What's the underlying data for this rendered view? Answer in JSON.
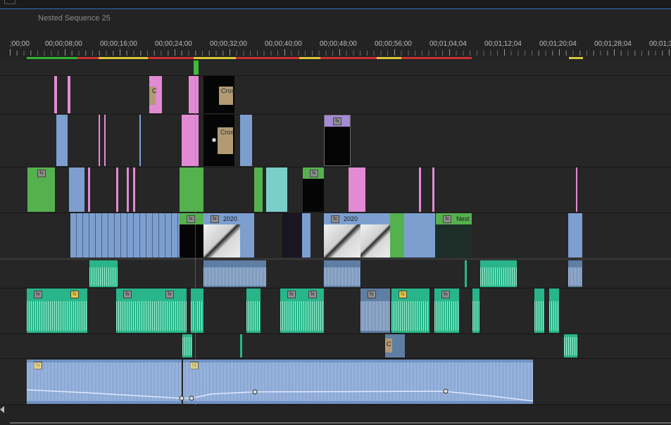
{
  "window": {
    "tab_title": "Nested Sequence 25"
  },
  "ruler": {
    "timecodes": [
      ";00;00",
      "00;00;08;00",
      "00;00;16;00",
      "00;00;24;00",
      "00;00;32;00",
      "00;00;40;00",
      "00;00;48;00",
      "00;00;56;00",
      "00;01;04;04",
      "00;01;12;04",
      "00;01;20;04",
      "00;01;28;04",
      "00;01;3"
    ]
  },
  "clips": {
    "cross_label_1": "Cros",
    "cross_label_2": "Cros",
    "c_label": "C",
    "year_1": "2020",
    "year_2": "2020",
    "nest_label": "Nest",
    "c_label_2": "C"
  },
  "icons": {
    "fx": "fx"
  },
  "colors": {
    "video_nested": "#e38ad4",
    "video_clip": "#7c9fd0",
    "video_green": "#55b14e",
    "audio_green": "#28b589",
    "audio_blue": "#5e7ea3",
    "playhead": "#3dbb3d"
  }
}
